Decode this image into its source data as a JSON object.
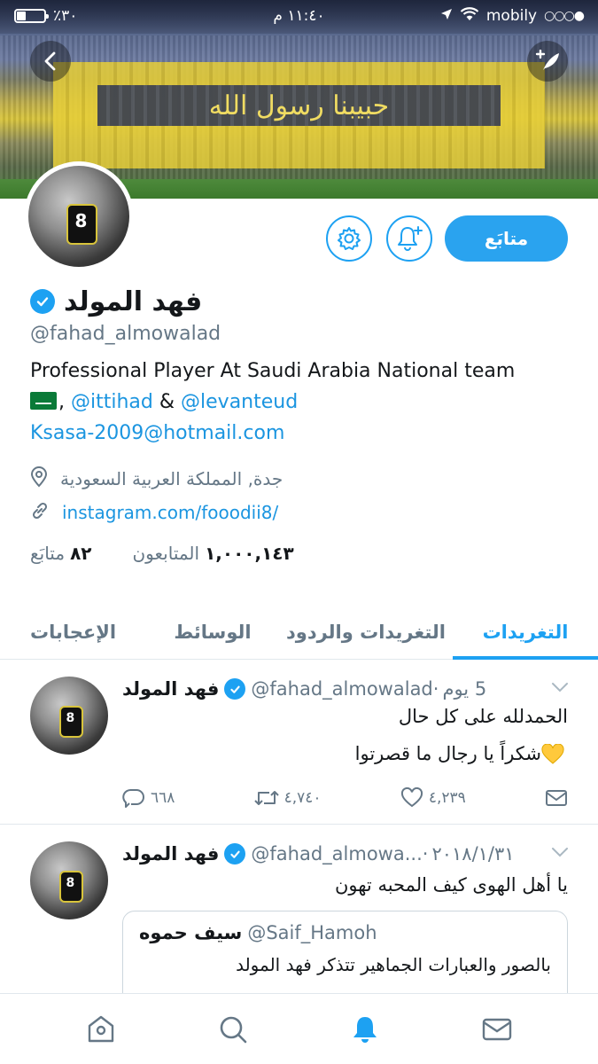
{
  "status_bar": {
    "battery": "٪٣٠",
    "battery_level": 0.3,
    "time": "١١:٤٠ م",
    "carrier": "mobily",
    "signal_dots": "○○○●"
  },
  "header": {
    "banner_text": "حبيبنا رسول الله"
  },
  "profile": {
    "display_name": "فهد المولد",
    "handle": "@fahad_almowalad",
    "follow_label": "متابَع",
    "bio_line1": "Professional Player At Saudi Arabia National team",
    "bio_comma": ",",
    "bio_mention1": "@ittihad",
    "bio_amp": "&",
    "bio_mention2": "@levanteud",
    "bio_email": "Ksasa-2009@hotmail.com",
    "location": "جدة, المملكة العربية السعودية",
    "website": "instagram.com/fooodii8/",
    "following_count": "٨٢",
    "following_label": "متابَع",
    "followers_count": "١,٠٠٠,١٤٣",
    "followers_label": "المتابعون"
  },
  "tabs": [
    {
      "label": "التغريدات",
      "active": true
    },
    {
      "label": "التغريدات والردود",
      "active": false
    },
    {
      "label": "الوسائط",
      "active": false
    },
    {
      "label": "الإعجابات",
      "active": false
    }
  ],
  "tweets": [
    {
      "name": "فهد المولد",
      "handle": "@fahad_almowalad",
      "separator": "·",
      "time": "5 يوم",
      "line1": "الحمدلله على كل حال",
      "line2": "شكراً يا رجال ما قصرتوا",
      "replies": "٦٦٨",
      "retweets": "٤,٧٤٠",
      "likes": "٤,٢٣٩"
    },
    {
      "name": "فهد المولد",
      "handle": "@fahad_almowa...",
      "separator": "·",
      "time": "٢٠١٨/١/٣١",
      "line1": "يا أهل الهوى كيف المحبه تهون",
      "quote": {
        "name": "سيف حموه",
        "handle": "@Saif_Hamoh",
        "text": "بالصور والعبارات الجماهير تتذكر فهد المولد"
      }
    }
  ],
  "colors": {
    "accent": "#1da1f2",
    "follow_bg": "#2aa3ef",
    "muted": "#657786",
    "link": "#1b95e0"
  },
  "icons": [
    "back-arrow-icon",
    "compose-icon",
    "gear-icon",
    "bell-plus-icon",
    "verified-icon",
    "location-pin-icon",
    "link-icon",
    "chevron-down-icon",
    "reply-icon",
    "retweet-icon",
    "heart-icon",
    "mail-icon",
    "home-icon",
    "search-icon",
    "notifications-icon",
    "messages-icon"
  ]
}
